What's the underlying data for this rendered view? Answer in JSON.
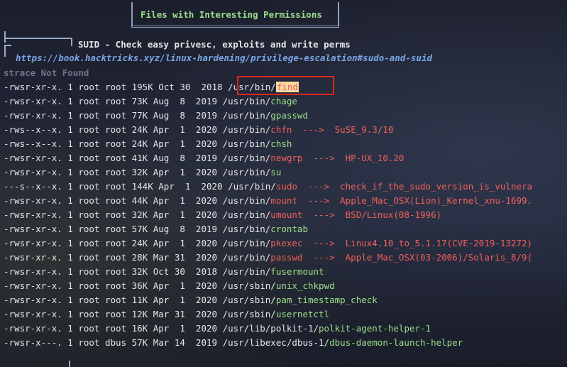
{
  "header": {
    "title": "Files with Interesting Permissions"
  },
  "section": {
    "title": "SUID - Check easy privesc, exploits and write perms",
    "link": "https://book.hacktricks.xyz/linux-hardening/privilege-escalation#sudo-and-suid",
    "note": "strace Not Found"
  },
  "colors": {
    "background": "#1b1e2b",
    "green": "#9be08a",
    "red": "#f0605a",
    "link": "#7aa6e6",
    "highlight": "#e0251a"
  },
  "rows": [
    {
      "perm": "-rwsr-xr-x. 1 root root 195K Oct 30  2018 ",
      "dir": "/usr/bin/",
      "bin": "find",
      "exploit": "",
      "style": "find"
    },
    {
      "perm": "-rwsr-xr-x. 1 root root 73K Aug  8  2019 ",
      "dir": "/usr/bin/",
      "bin": "chage",
      "exploit": "",
      "style": "green"
    },
    {
      "perm": "-rwsr-xr-x. 1 root root 77K Aug  8  2019 ",
      "dir": "/usr/bin/",
      "bin": "gpasswd",
      "exploit": "",
      "style": "green"
    },
    {
      "perm": "-rws--x--x. 1 root root 24K Apr  1  2020 ",
      "dir": "/usr/bin/",
      "bin": "chfn",
      "exploit": "  --->  SuSE_9.3/10",
      "style": "red"
    },
    {
      "perm": "-rws--x--x. 1 root root 24K Apr  1  2020 ",
      "dir": "/usr/bin/",
      "bin": "chsh",
      "exploit": "",
      "style": "green"
    },
    {
      "perm": "-rwsr-xr-x. 1 root root 41K Aug  8  2019 ",
      "dir": "/usr/bin/",
      "bin": "newgrp",
      "exploit": "  --->  HP-UX_10.20",
      "style": "red"
    },
    {
      "perm": "-rwsr-xr-x. 1 root root 32K Apr  1  2020 ",
      "dir": "/usr/bin/",
      "bin": "su",
      "exploit": "",
      "style": "green"
    },
    {
      "perm": "---s--x--x. 1 root root 144K Apr  1  2020 ",
      "dir": "/usr/bin/",
      "bin": "sudo",
      "exploit": "  --->  check_if_the_sudo_version_is_vulnera",
      "style": "red"
    },
    {
      "perm": "-rwsr-xr-x. 1 root root 44K Apr  1  2020 ",
      "dir": "/usr/bin/",
      "bin": "mount",
      "exploit": "  --->  Apple_Mac_OSX(Lion)_Kernel_xnu-1699.",
      "style": "red"
    },
    {
      "perm": "-rwsr-xr-x. 1 root root 32K Apr  1  2020 ",
      "dir": "/usr/bin/",
      "bin": "umount",
      "exploit": "  --->  BSD/Linux(08-1996)",
      "style": "red"
    },
    {
      "perm": "-rwsr-xr-x. 1 root root 57K Aug  8  2019 ",
      "dir": "/usr/bin/",
      "bin": "crontab",
      "exploit": "",
      "style": "green"
    },
    {
      "perm": "-rwsr-xr-x. 1 root root 24K Apr  1  2020 ",
      "dir": "/usr/bin/",
      "bin": "pkexec",
      "exploit": "  --->  Linux4.10_to_5.1.17(CVE-2019-13272)",
      "style": "red"
    },
    {
      "perm": "-rwsr-xr-x. 1 root root 28K Mar 31  2020 ",
      "dir": "/usr/bin/",
      "bin": "passwd",
      "exploit": "  --->  Apple_Mac_OSX(03-2006)/Solaris_8/9(",
      "style": "red"
    },
    {
      "perm": "-rwsr-xr-x. 1 root root 32K Oct 30  2018 ",
      "dir": "/usr/bin/",
      "bin": "fusermount",
      "exploit": "",
      "style": "green"
    },
    {
      "perm": "-rwsr-xr-x. 1 root root 36K Apr  1  2020 ",
      "dir": "/usr/sbin/",
      "bin": "unix_chkpwd",
      "exploit": "",
      "style": "green"
    },
    {
      "perm": "-rwsr-xr-x. 1 root root 11K Apr  1  2020 ",
      "dir": "/usr/sbin/",
      "bin": "pam_timestamp_check",
      "exploit": "",
      "style": "green"
    },
    {
      "perm": "-rwsr-xr-x. 1 root root 12K Mar 31  2020 ",
      "dir": "/usr/sbin/",
      "bin": "usernetctl",
      "exploit": "",
      "style": "green"
    },
    {
      "perm": "-rwsr-xr-x. 1 root root 16K Apr  1  2020 ",
      "dir": "/usr/lib/polkit-1/",
      "bin": "polkit-agent-helper-1",
      "exploit": "",
      "style": "green"
    },
    {
      "perm": "-rwsr-x---. 1 root dbus 57K Mar 14  2019 ",
      "dir": "/usr/libexec/dbus-1/",
      "bin": "dbus-daemon-launch-helper",
      "exploit": "",
      "style": "green"
    }
  ]
}
